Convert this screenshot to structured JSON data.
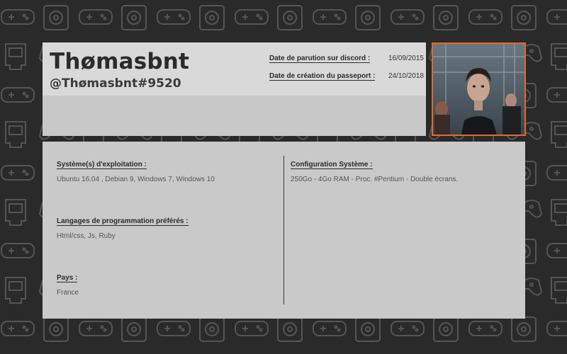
{
  "profile": {
    "username": "Thømasbnt",
    "tag": "@Thømasbnt#9520",
    "discord_date_label": "Date de parution sur discord :",
    "discord_date_value": "16/09/2015",
    "passport_date_label": "Date de création du passeport :",
    "passport_date_value": "24/10/2018"
  },
  "avatar": {
    "border_color": "#e46b22"
  },
  "info": {
    "os_label": "Système(s) d'exploitation :",
    "os_value": "Ubuntu 16.04 , Debian 9, Windows 7, Windows 10",
    "langs_label": "Langages de programmation préférés :",
    "langs_value": "Html/css, Js, Ruby",
    "country_label": "Pays :",
    "country_value": "France",
    "config_label": "Configuration Système :",
    "config_value": "250Go - 4Go RAM - Proc. #Pentium - Double écrans."
  },
  "background": {
    "color": "#2a2a2a",
    "pattern_icons": [
      "gamepad-icon",
      "console-icon",
      "game-cartridge-icon"
    ]
  }
}
